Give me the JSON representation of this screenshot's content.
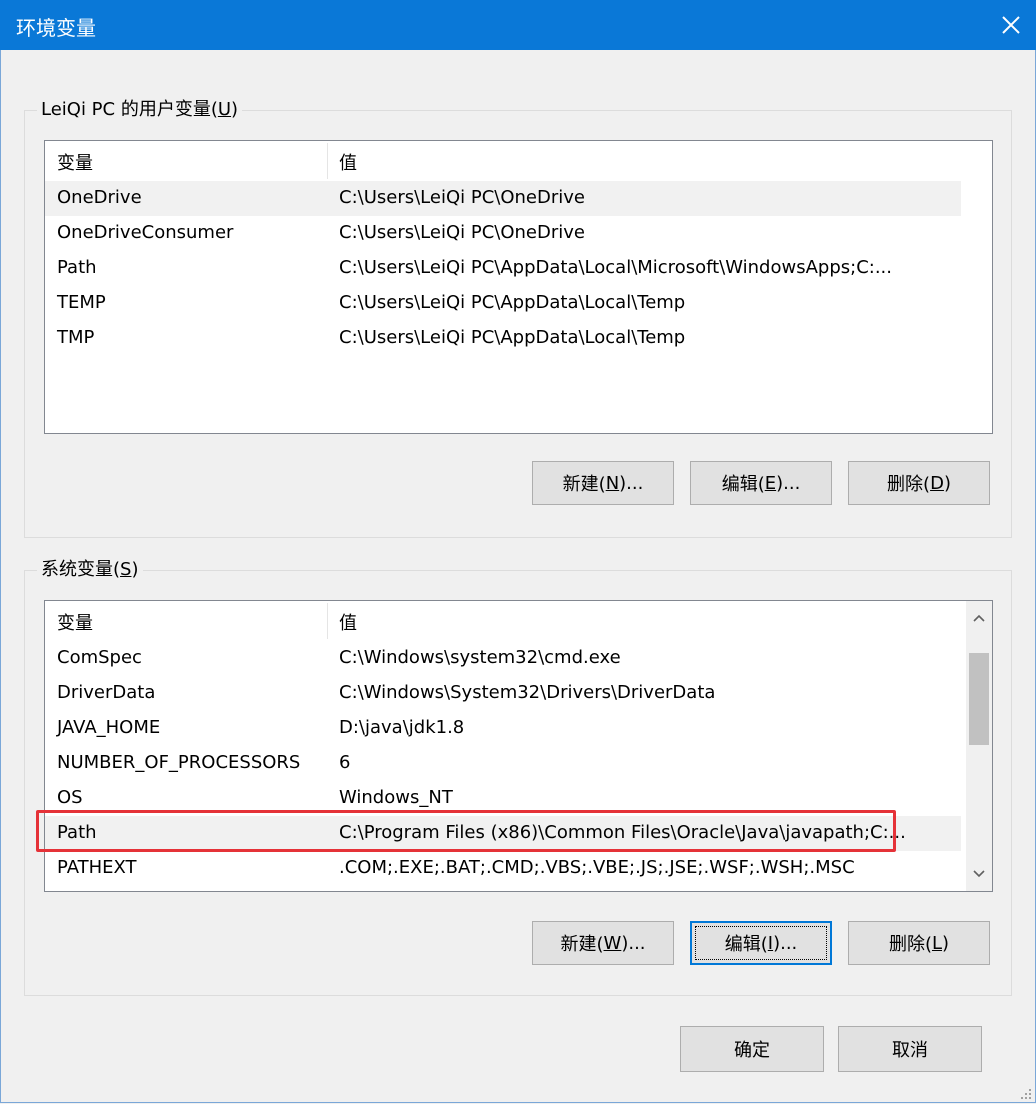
{
  "window": {
    "title": "环境变量"
  },
  "user_group": {
    "legend_prefix": "LeiQi PC 的用户变量(",
    "legend_mnemonic": "U",
    "legend_suffix": ")",
    "columns": {
      "variable": "变量",
      "value": "值"
    },
    "rows": [
      {
        "variable": "OneDrive",
        "value": "C:\\Users\\LeiQi PC\\OneDrive"
      },
      {
        "variable": "OneDriveConsumer",
        "value": "C:\\Users\\LeiQi PC\\OneDrive"
      },
      {
        "variable": "Path",
        "value": "C:\\Users\\LeiQi PC\\AppData\\Local\\Microsoft\\WindowsApps;C:..."
      },
      {
        "variable": "TEMP",
        "value": "C:\\Users\\LeiQi PC\\AppData\\Local\\Temp"
      },
      {
        "variable": "TMP",
        "value": "C:\\Users\\LeiQi PC\\AppData\\Local\\Temp"
      }
    ],
    "buttons": {
      "new": {
        "prefix": "新建(",
        "mnemonic": "N",
        "suffix": ")..."
      },
      "edit": {
        "prefix": "编辑(",
        "mnemonic": "E",
        "suffix": ")..."
      },
      "delete": {
        "prefix": "删除(",
        "mnemonic": "D",
        "suffix": ")"
      }
    }
  },
  "system_group": {
    "legend_prefix": "系统变量(",
    "legend_mnemonic": "S",
    "legend_suffix": ")",
    "columns": {
      "variable": "变量",
      "value": "值"
    },
    "rows": [
      {
        "variable": "ComSpec",
        "value": "C:\\Windows\\system32\\cmd.exe"
      },
      {
        "variable": "DriverData",
        "value": "C:\\Windows\\System32\\Drivers\\DriverData"
      },
      {
        "variable": "JAVA_HOME",
        "value": "D:\\java\\jdk1.8"
      },
      {
        "variable": "NUMBER_OF_PROCESSORS",
        "value": "6"
      },
      {
        "variable": "OS",
        "value": "Windows_NT"
      },
      {
        "variable": "Path",
        "value": "C:\\Program Files (x86)\\Common Files\\Oracle\\Java\\javapath;C:..."
      },
      {
        "variable": "PATHEXT",
        "value": ".COM;.EXE;.BAT;.CMD;.VBS;.VBE;.JS;.JSE;.WSF;.WSH;.MSC"
      }
    ],
    "buttons": {
      "new": {
        "prefix": "新建(",
        "mnemonic": "W",
        "suffix": ")..."
      },
      "edit": {
        "prefix": "编辑(",
        "mnemonic": "I",
        "suffix": ")..."
      },
      "delete": {
        "prefix": "删除(",
        "mnemonic": "L",
        "suffix": ")"
      }
    }
  },
  "footer": {
    "ok": "确定",
    "cancel": "取消"
  },
  "colors": {
    "titlebar": "#0a78d7",
    "highlight": "#e53238",
    "focus": "#0078d7"
  },
  "icons": {
    "close": "close-icon",
    "scroll_up": "chevron-up-icon",
    "scroll_down": "chevron-down-icon"
  }
}
